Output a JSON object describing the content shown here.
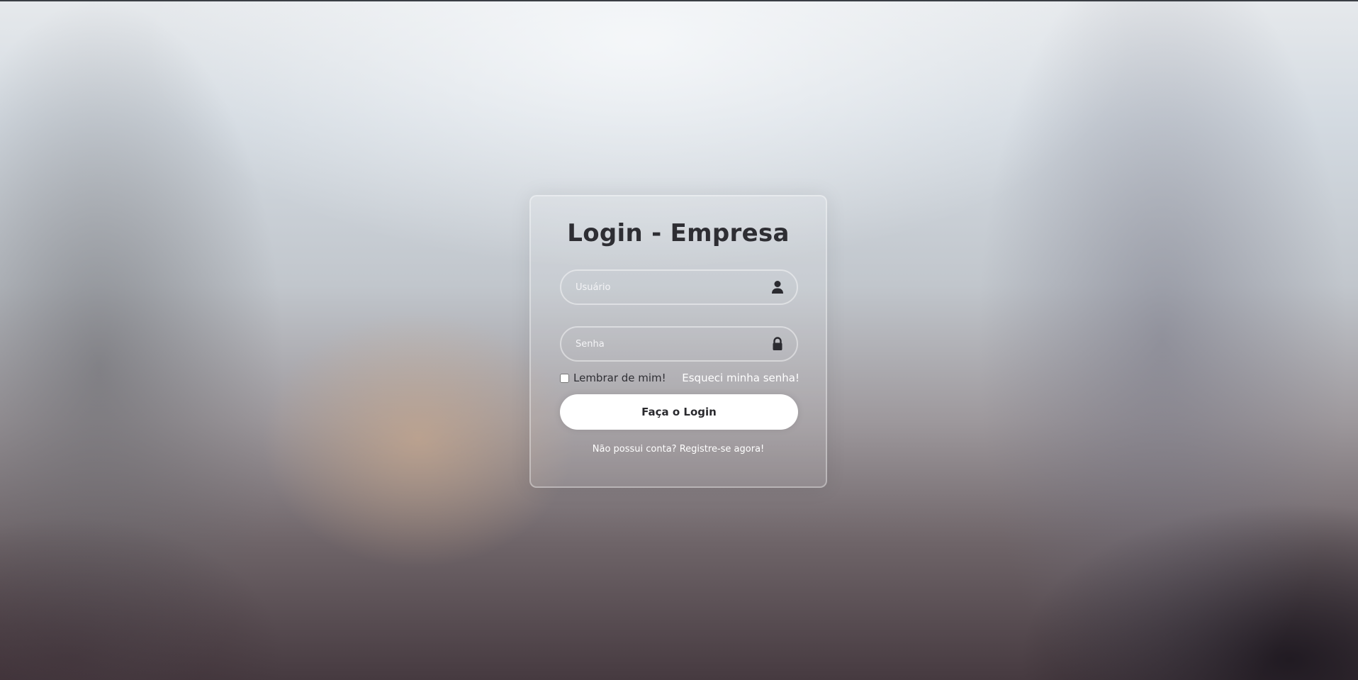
{
  "form": {
    "title": "Login - Empresa",
    "username_placeholder": "Usuário",
    "password_placeholder": "Senha",
    "remember_label": "Lembrar de mim!",
    "remember_checked": false,
    "forgot_link": "Esqueci minha senha!",
    "submit_label": "Faça o Login",
    "register_prompt": "Não possui conta?",
    "register_link": "Registre-se agora!"
  },
  "icons": {
    "username": "user-icon",
    "password": "lock-icon"
  },
  "colors": {
    "title": "#2e2e33",
    "button_background": "#ffffff",
    "button_text": "#2a2a2e",
    "link_text": "#ffffff"
  }
}
